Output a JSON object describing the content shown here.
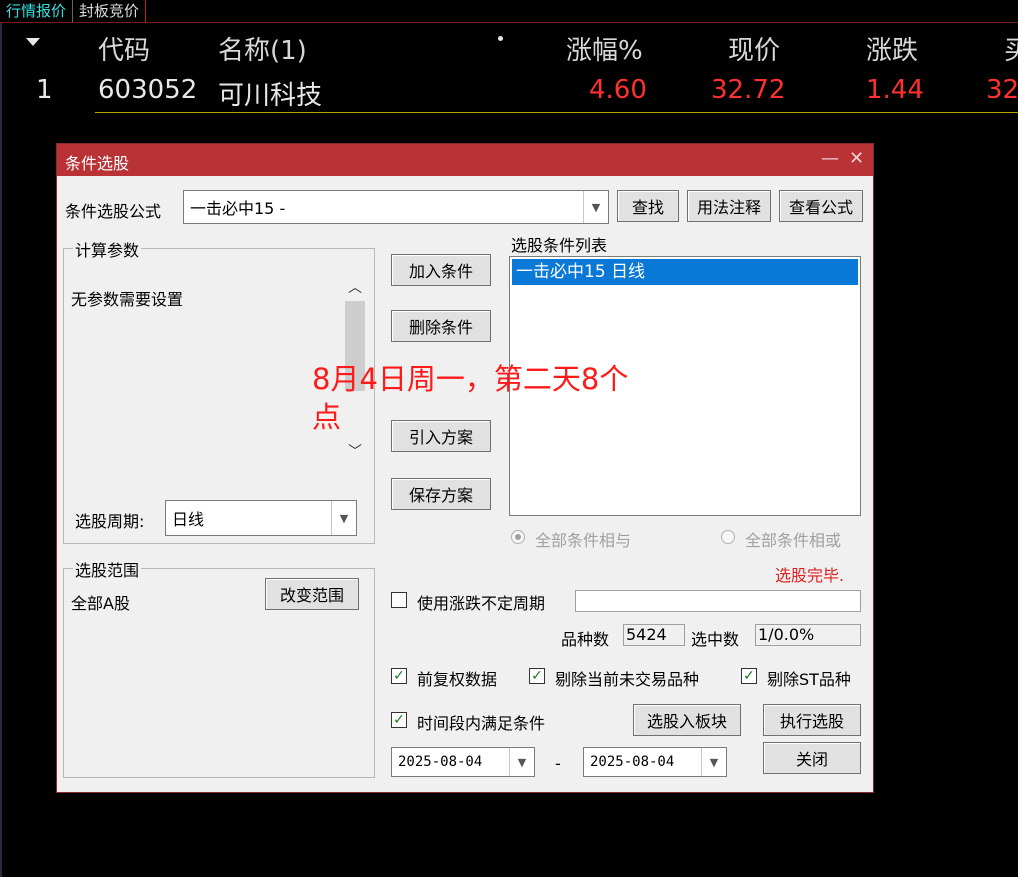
{
  "tabs": [
    "行情报价",
    "封板竞价"
  ],
  "table": {
    "headers": [
      "代码",
      "名称(1)",
      "涨幅%",
      "现价",
      "涨跌",
      "买"
    ],
    "rows": [
      {
        "index": "1",
        "code": "603052",
        "name": "可川科技",
        "change_pct": "4.60",
        "price": "32.72",
        "change": "1.44",
        "bid": "32"
      }
    ]
  },
  "dialog": {
    "title": "条件选股",
    "formula_label": "条件选股公式",
    "formula_value": "一击必中15  -",
    "find_button": "查找",
    "usage_button": "用法注释",
    "view_button": "查看公式",
    "params_group": "计算参数",
    "params_text": "无参数需要设置",
    "period_label": "选股周期:",
    "period_value": "日线",
    "scope_group": "选股范围",
    "scope_value": "全部A股",
    "change_scope_button": "改变范围",
    "add_condition": "加入条件",
    "delete_condition": "删除条件",
    "import_plan": "引入方案",
    "save_plan": "保存方案",
    "condition_list_label": "选股条件列表",
    "condition_items": [
      "一击必中15  日线"
    ],
    "radio_and": "全部条件相与",
    "radio_or": "全部条件相或",
    "status": "选股完毕.",
    "use_variable_period": "使用涨跌不定周期",
    "count_label": "品种数",
    "count_value": "5424",
    "selected_label": "选中数",
    "selected_value": "1/0.0%",
    "chk_adjusted": "前复权数据",
    "chk_exclude_untraded": "剔除当前未交易品种",
    "chk_exclude_st": "剔除ST品种",
    "chk_time_range": "时间段内满足条件",
    "to_block_button": "选股入板块",
    "execute_button": "执行选股",
    "date_from": "2025-08-04",
    "date_sep": "-",
    "date_to": "2025-08-04",
    "close_button": "关闭"
  },
  "annotation": "8月4日周一，第二天8个点",
  "colors": {
    "up_red": "#ff3030",
    "title_bar": "#b83236",
    "selection_blue": "#0a78d7"
  }
}
